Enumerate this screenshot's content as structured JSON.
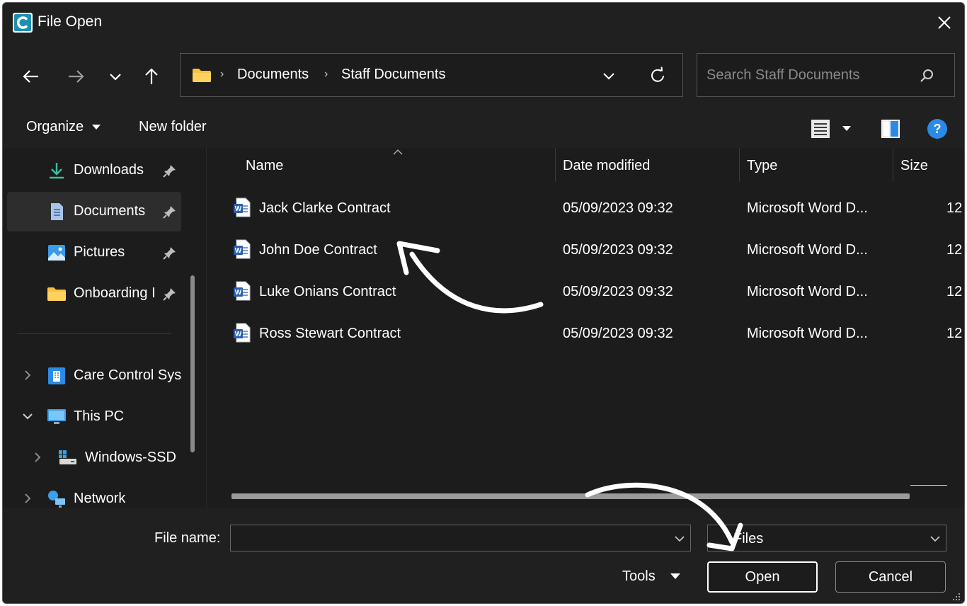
{
  "window": {
    "title": "File Open",
    "app_logo_icon": "care-control-logo-icon",
    "close_icon": "close-icon"
  },
  "navigation": {
    "back_icon": "arrow-left-icon",
    "forward_icon": "arrow-right-icon",
    "recent_icon": "chevron-down-icon",
    "up_icon": "arrow-up-icon"
  },
  "address": {
    "folder_icon": "folder-icon",
    "breadcrumbs": [
      "Documents",
      "Staff Documents"
    ],
    "dropdown_icon": "chevron-down-icon",
    "refresh_icon": "refresh-icon"
  },
  "search": {
    "placeholder": "Search Staff Documents",
    "icon": "search-icon"
  },
  "toolbar": {
    "organize_label": "Organize",
    "new_folder_label": "New folder",
    "view_icon": "details-view-icon",
    "preview_icon": "preview-pane-icon",
    "help_icon": "help-icon"
  },
  "sidebar": {
    "quick_access": [
      {
        "label": "Downloads",
        "icon": "download-icon",
        "pinned": true
      },
      {
        "label": "Documents",
        "icon": "document-icon",
        "pinned": true,
        "selected": true
      },
      {
        "label": "Pictures",
        "icon": "pictures-icon",
        "pinned": true
      },
      {
        "label": "Onboarding I",
        "icon": "folder-icon",
        "pinned": true
      }
    ],
    "tree": [
      {
        "label": "Care Control Sys",
        "icon": "building-icon",
        "expanded": false
      },
      {
        "label": "This PC",
        "icon": "monitor-icon",
        "expanded": true
      },
      {
        "label": "Windows-SSD",
        "icon": "drive-icon",
        "expanded": false
      },
      {
        "label": "Network",
        "icon": "network-icon",
        "expanded": false
      }
    ]
  },
  "filelist": {
    "columns": [
      "Name",
      "Date modified",
      "Type",
      "Size"
    ],
    "rows": [
      {
        "name": "Jack Clarke Contract",
        "date": "05/09/2023 09:32",
        "type": "Microsoft Word D...",
        "size": "12"
      },
      {
        "name": "John Doe Contract",
        "date": "05/09/2023 09:32",
        "type": "Microsoft Word D...",
        "size": "12"
      },
      {
        "name": "Luke Onians Contract",
        "date": "05/09/2023 09:32",
        "type": "Microsoft Word D...",
        "size": "12"
      },
      {
        "name": "Ross Stewart Contract",
        "date": "05/09/2023 09:32",
        "type": "Microsoft Word D...",
        "size": "12"
      }
    ],
    "file_icon": "word-document-icon"
  },
  "footer": {
    "file_name_label": "File name:",
    "file_name_value": "",
    "file_type_value": "Files",
    "tools_label": "Tools",
    "open_label": "Open",
    "cancel_label": "Cancel"
  },
  "colors": {
    "window_bg": "#1c1c1c",
    "chrome_bg": "#202020",
    "selected_bg": "#2d2d2d",
    "accent_blue": "#2b8ae6",
    "folder_yellow": "#f5c242",
    "word_blue": "#2b5fb4"
  }
}
